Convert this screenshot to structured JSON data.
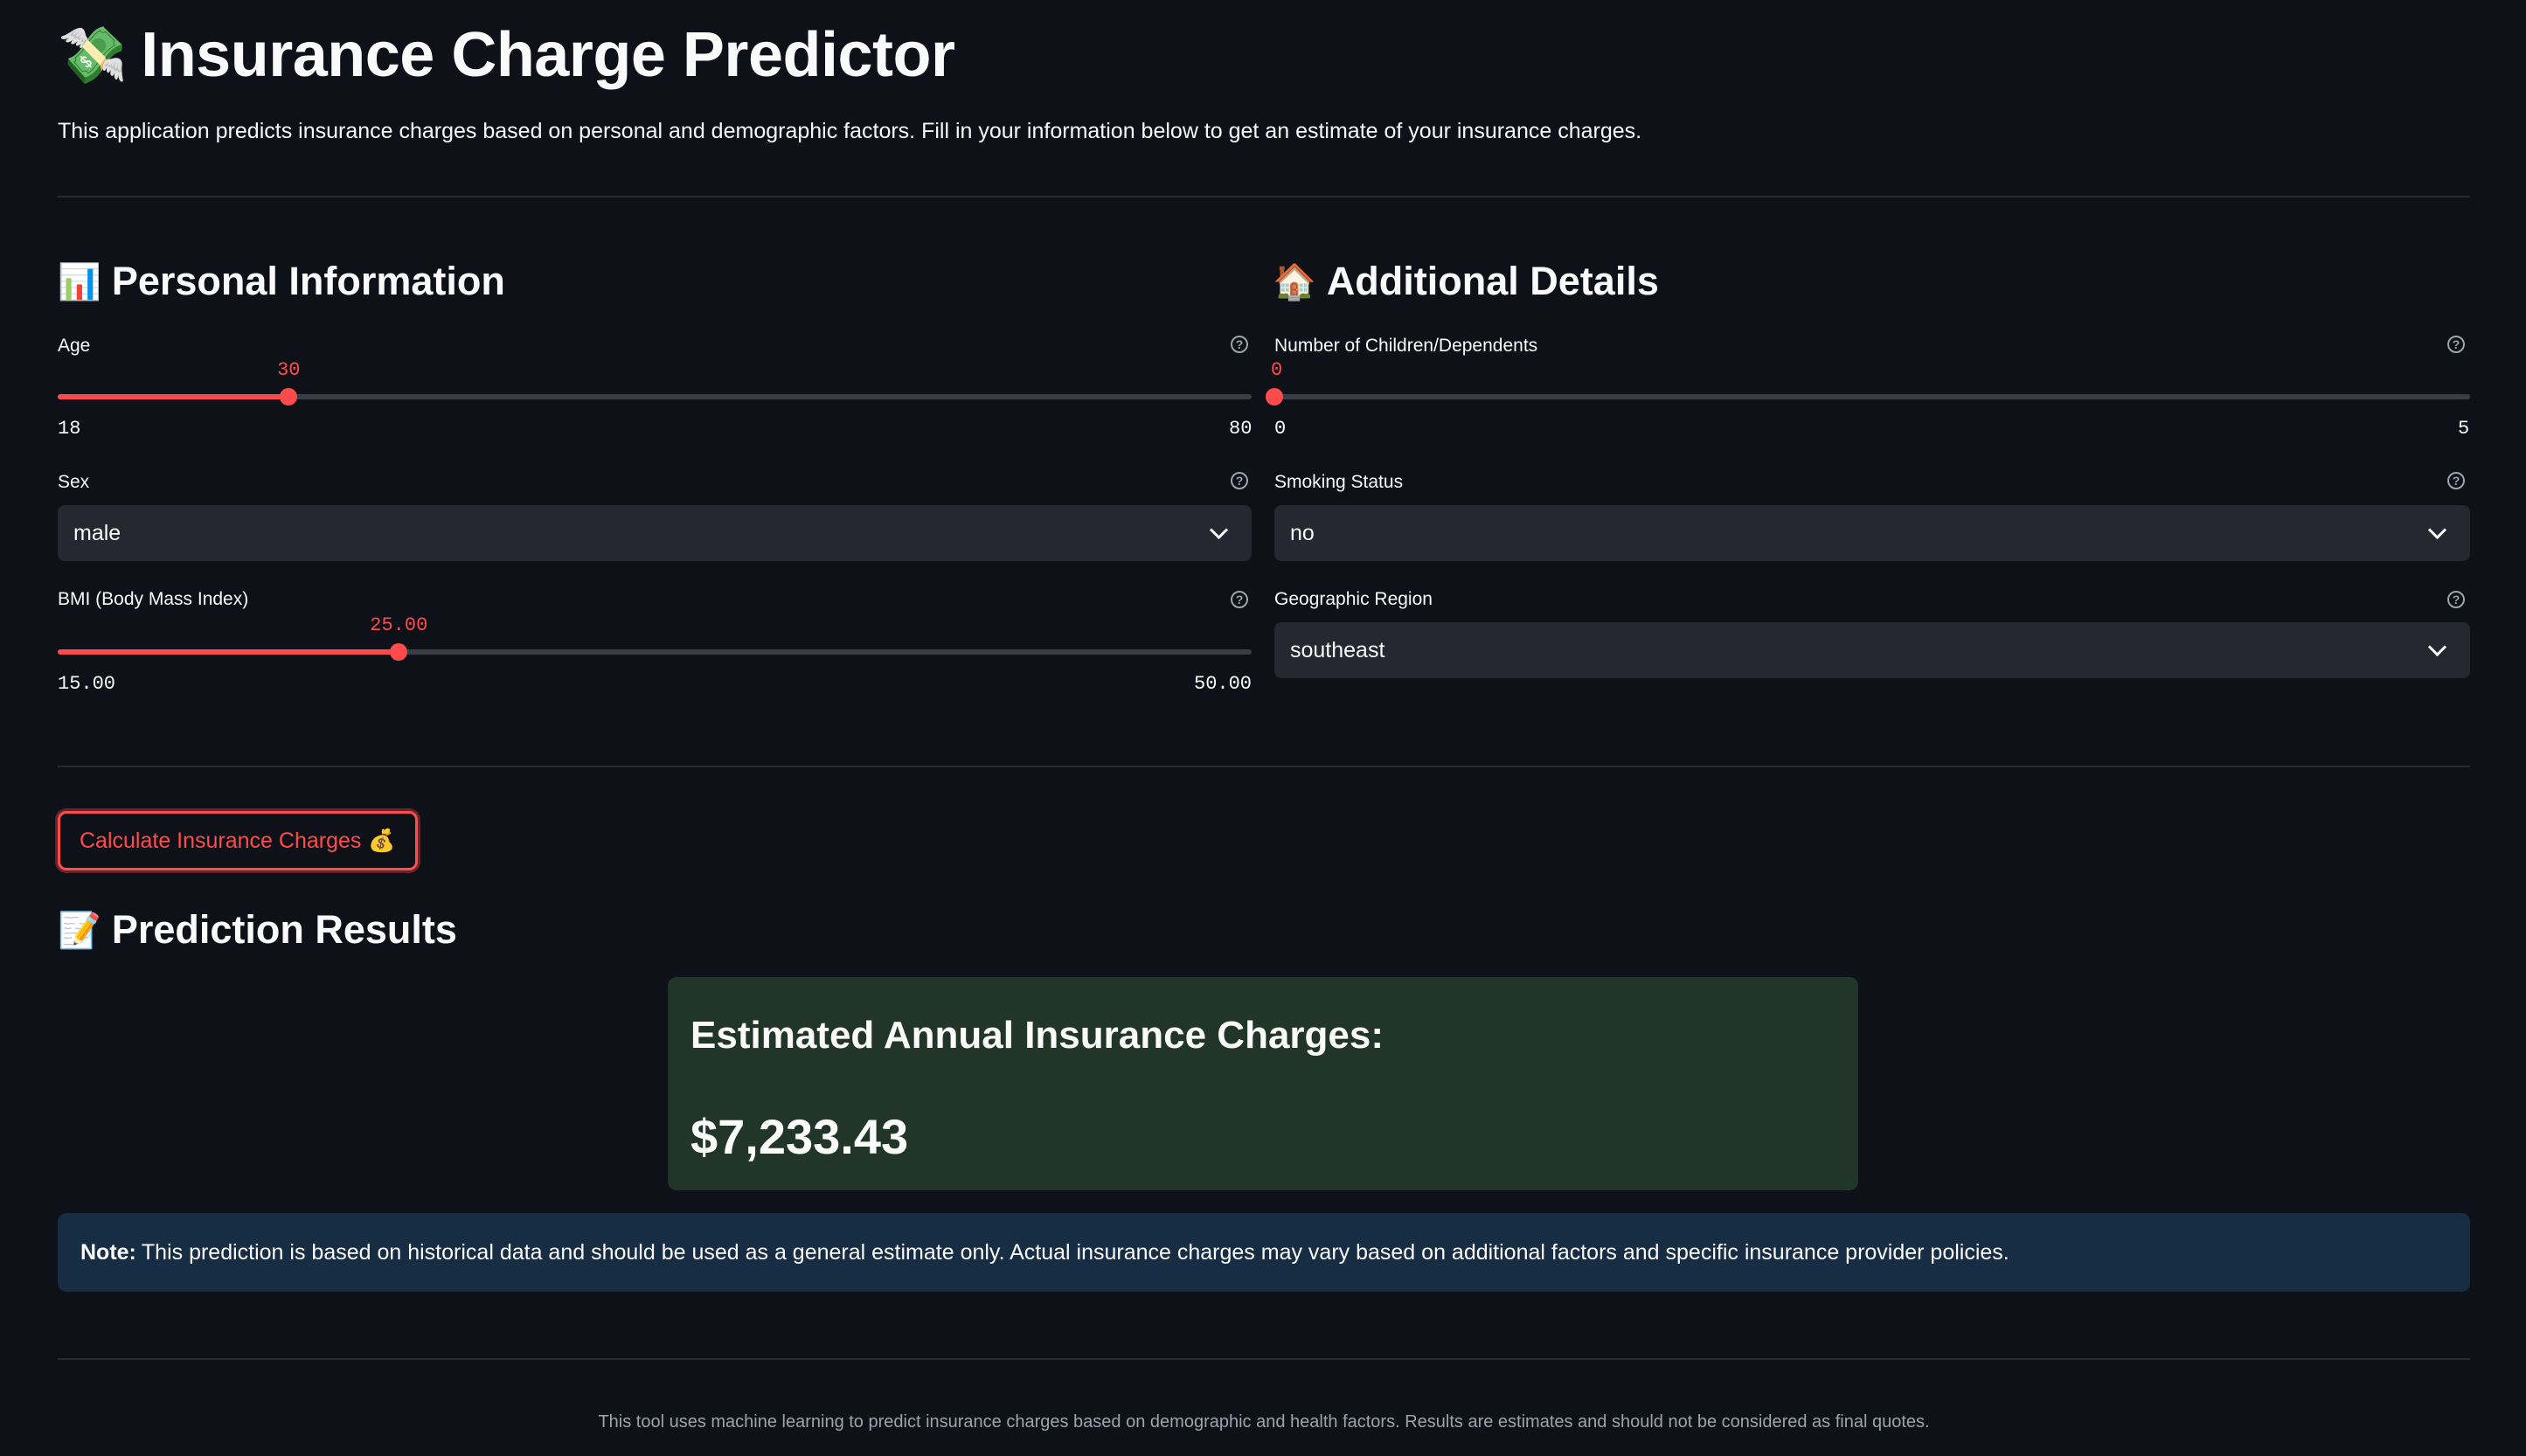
{
  "app": {
    "title": "Insurance Charge Predictor",
    "title_icon": "money-with-wings-icon",
    "description": "This application predicts insurance charges based on personal and demographic factors. Fill in your information below to get an estimate of your insurance charges."
  },
  "personal": {
    "heading": "Personal Information",
    "heading_icon": "bar-chart-icon",
    "age": {
      "label": "Age",
      "value": "30",
      "min": "18",
      "max": "80",
      "fraction": 0.1935
    },
    "sex": {
      "label": "Sex",
      "value": "male"
    },
    "bmi": {
      "label": "BMI (Body Mass Index)",
      "value": "25.00",
      "min": "15.00",
      "max": "50.00",
      "fraction": 0.2857
    }
  },
  "additional": {
    "heading": "Additional Details",
    "heading_icon": "house-icon",
    "children": {
      "label": "Number of Children/Dependents",
      "value": "0",
      "min": "0",
      "max": "5",
      "fraction": 0
    },
    "smoking": {
      "label": "Smoking Status",
      "value": "no"
    },
    "region": {
      "label": "Geographic Region",
      "value": "southeast"
    }
  },
  "calculate_button": {
    "label": "Calculate Insurance Charges",
    "icon": "money-bag-icon"
  },
  "results": {
    "heading": "Prediction Results",
    "heading_icon": "memo-icon",
    "box_title": "Estimated Annual Insurance Charges:",
    "value": "$7,233.43"
  },
  "note": {
    "prefix": "Note:",
    "text": "This prediction is based on historical data and should be used as a general estimate only. Actual insurance charges may vary based on additional factors and specific insurance provider policies."
  },
  "footer": "This tool uses machine learning to predict insurance charges based on demographic and health factors. Results are estimates and should not be considered as final quotes.",
  "colors": {
    "background": "#0e1117",
    "accent": "#ff4b4b",
    "result_bg": "#213529",
    "note_bg": "#172d43",
    "input_bg": "#262730"
  }
}
